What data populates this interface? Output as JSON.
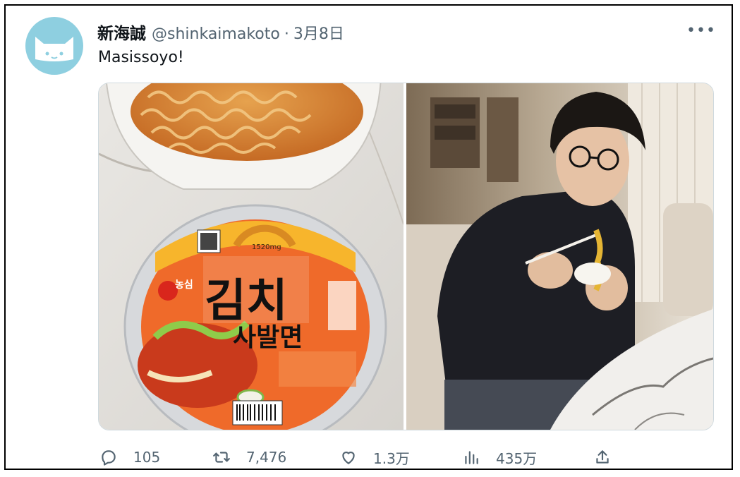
{
  "tweet": {
    "display_name": "新海誠",
    "handle": "@shinkaimakoto",
    "separator": "·",
    "date": "3月8日",
    "text": "Masissoyo!",
    "more_label": "•••"
  },
  "media": {
    "left_image": {
      "brand": "농심",
      "title_line1": "김치",
      "title_line2": "사발면",
      "calorie_label": "1520mg"
    },
    "right_image": {}
  },
  "actions": {
    "replies": "105",
    "reposts": "7,476",
    "likes": "1.3万",
    "views": "435万"
  },
  "colors": {
    "text_primary": "#0f1419",
    "text_secondary": "#536471",
    "avatar_bg": "#8ecfe0",
    "border": "#cfd9de"
  },
  "icons": {
    "avatar": "cat-face-icon",
    "reply": "reply-bubble-icon",
    "repost": "repost-arrows-icon",
    "like": "heart-icon",
    "views": "bar-chart-icon",
    "share": "share-upload-icon",
    "more": "more-dots-icon"
  }
}
